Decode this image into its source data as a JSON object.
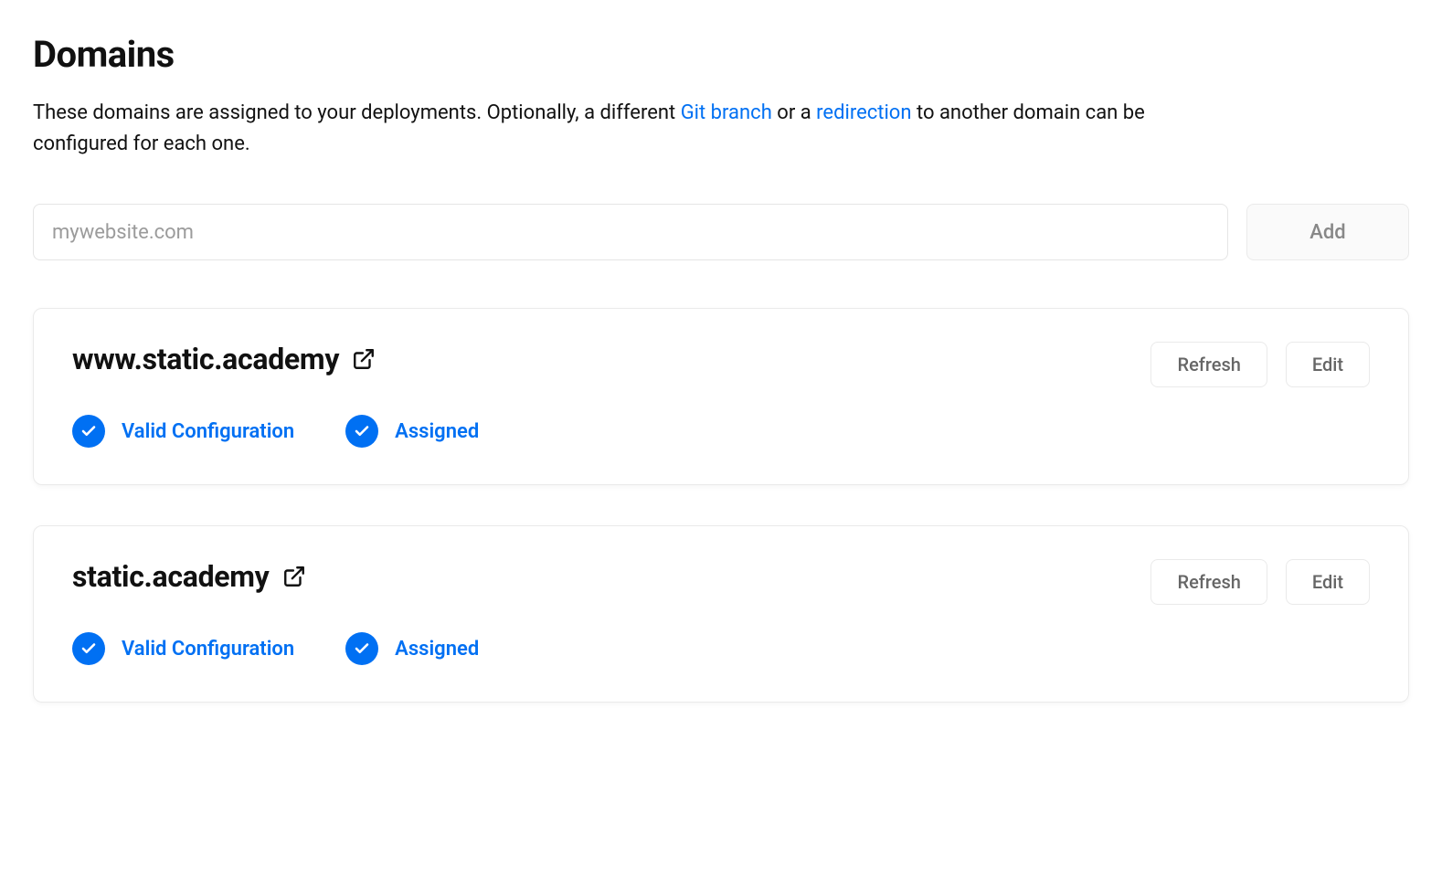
{
  "title": "Domains",
  "description": {
    "part1": "These domains are assigned to your deployments. Optionally, a different ",
    "link1": "Git branch",
    "part2": " or a ",
    "link2": "redirection",
    "part3": " to another domain can be configured for each one."
  },
  "add": {
    "placeholder": "mywebsite.com",
    "button": "Add"
  },
  "buttons": {
    "refresh": "Refresh",
    "edit": "Edit"
  },
  "status": {
    "valid_config": "Valid Configuration",
    "assigned": "Assigned"
  },
  "domains": [
    {
      "name": "www.static.academy"
    },
    {
      "name": "static.academy"
    }
  ]
}
